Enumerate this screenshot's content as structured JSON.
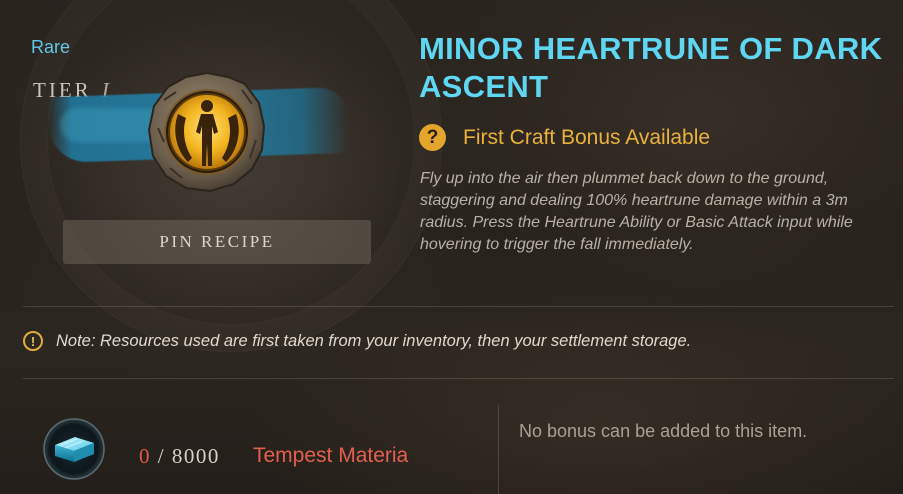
{
  "item": {
    "rarity": "Rare",
    "tier_label": "TIER",
    "tier_numeral": "I",
    "title": "MINOR HEARTRUNE OF DARK ASCENT",
    "icon": "heartrune-dark-ascent-icon"
  },
  "actions": {
    "pin_recipe_label": "PIN RECIPE"
  },
  "bonus": {
    "icon": "question-mark-icon",
    "text": "First Craft Bonus Available"
  },
  "description": "Fly up into the air then plummet back down to the ground, staggering and dealing 100% heartrune damage within a 3m radius. Press the Heartrune Ability or Basic Attack input while hovering to trigger the fall immediately.",
  "note": {
    "icon": "exclamation-icon",
    "text": "Note: Resources used are first taken from your inventory, then your settlement storage."
  },
  "resources": [
    {
      "icon": "tempest-materia-icon",
      "have": "0",
      "separator": "/",
      "need": "8000",
      "name": "Tempest Materia"
    }
  ],
  "bonus_slot": {
    "text": "No bonus can be added to this item."
  },
  "colors": {
    "rarity": "#62c6e6",
    "title": "#5fd6f2",
    "bonus": "#eab23a",
    "insufficient": "#e05a4a"
  }
}
